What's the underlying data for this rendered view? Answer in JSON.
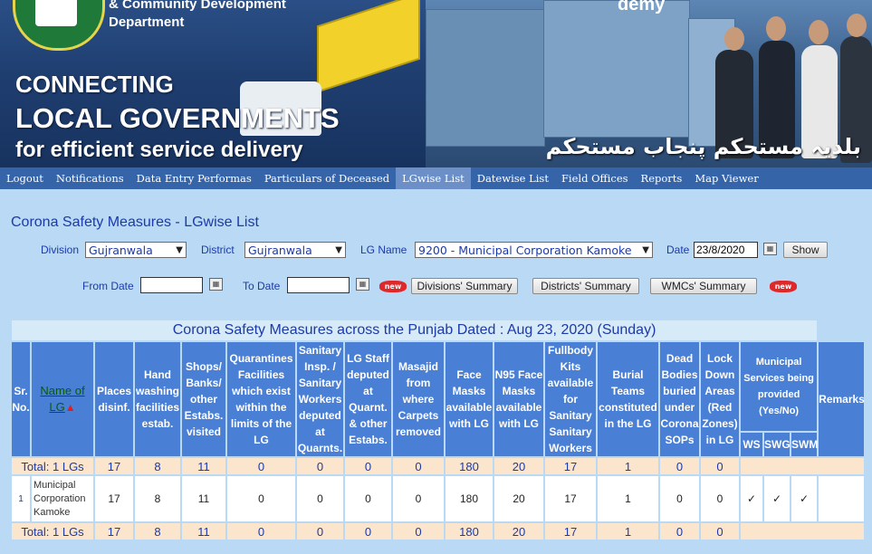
{
  "banner": {
    "dept_line1": "& Community Development",
    "dept_line2": "Department",
    "tagline1": "CONNECTING",
    "tagline2": "LOCAL GOVERNMENTS",
    "tagline3": "for efficient service delivery",
    "urdu": "بلدیہ مستحکم پنجاب مستحکم",
    "academy_fragment": "demy"
  },
  "nav": [
    "Logout",
    "Notifications",
    "Data Entry Performas",
    "Particulars of Deceased",
    "LGwise List",
    "Datewise List",
    "Field Offices",
    "Reports",
    "Map Viewer"
  ],
  "nav_active": "LGwise List",
  "page_title": "Corona Safety Measures - LGwise List",
  "filters": {
    "division_label": "Division",
    "division_value": "Gujranwala",
    "district_label": "District",
    "district_value": "Gujranwala",
    "lgname_label": "LG Name",
    "lgname_value": "9200 - Municipal Corporation Kamoke",
    "date_label": "Date",
    "date_value": "23/8/2020",
    "show_button": "Show",
    "from_label": "From Date",
    "from_value": "",
    "to_label": "To Date",
    "to_value": "",
    "new_badge": "new",
    "div_summary": "Divisions' Summary",
    "dist_summary": "Districts' Summary",
    "wmc_summary": "WMCs' Summary"
  },
  "table": {
    "caption": "Corona Safety Measures across the Punjab Dated : Aug 23, 2020 (Sunday)",
    "headers": {
      "sr": "Sr. No.",
      "lg": "Name of LG",
      "places": "Places disinf.",
      "hand": "Hand washing facilities estab.",
      "shops": "Shops/ Banks/ other Estabs. visited",
      "quarantine": "Quarantines Facilities which exist within the limits of the LG",
      "sanitary": "Sanitary Insp. / Sanitary Workers deputed at Quarnts.",
      "staff": "LG Staff deputed at Quarnt. & other Estabs.",
      "masajid": "Masajid from where Carpets removed",
      "face": "Face Masks available with LG",
      "n95": "N95 Face Masks available with LG",
      "kits": "Fullbody Kits available for Sanitary Sanitary Workers",
      "burial": "Burial Teams constituted in the LG",
      "dead": "Dead Bodies buried under Corona SOPs",
      "lock": "Lock Down Areas (Red Zones) in LG",
      "municipal": "Municipal Services being provided (Yes/No)",
      "ws": "WS",
      "swg": "SWG",
      "swm": "SWM",
      "remarks": "Remarks"
    },
    "total_label": "Total: 1 LGs",
    "totals": [
      "17",
      "8",
      "11",
      "0",
      "0",
      "0",
      "0",
      "180",
      "20",
      "17",
      "1",
      "0",
      "0"
    ],
    "row": {
      "sr": "1",
      "name": "Municipal Corporation Kamoke",
      "values": [
        "17",
        "8",
        "11",
        "0",
        "0",
        "0",
        "0",
        "180",
        "20",
        "17",
        "1",
        "0",
        "0"
      ],
      "ws": "✓",
      "swg": "✓",
      "swm": "✓",
      "remarks": ""
    }
  },
  "colors": {
    "nav": "#3564a8",
    "header": "#4a7fd6",
    "total_row": "#fbe5cc",
    "page": "#b9d9f5"
  }
}
